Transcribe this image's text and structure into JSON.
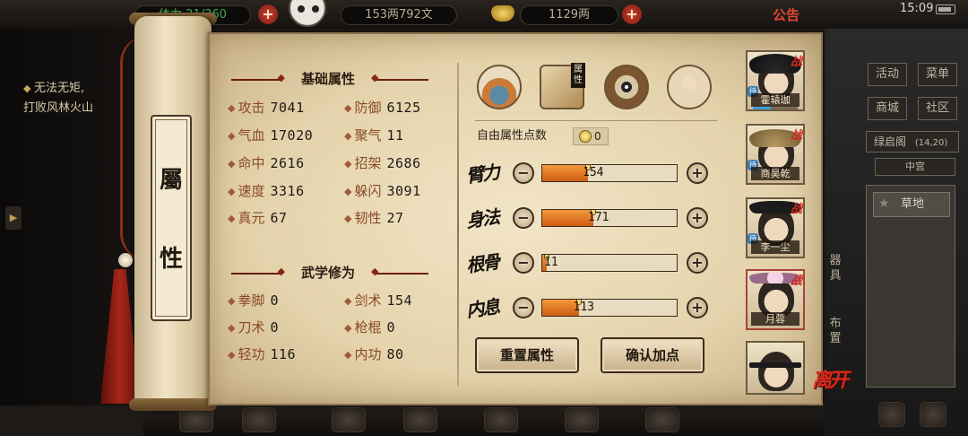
{
  "topbar": {
    "stamina": "21/360",
    "stamina_prefix": "体力",
    "money": "153两792文",
    "ingots": "1129两",
    "notice": "公告",
    "clock": "15:09"
  },
  "quest": {
    "title": "无法无矩,",
    "desc": "打败风林火山"
  },
  "scroll": {
    "char1": "屬",
    "char2": "性"
  },
  "basic": {
    "title": "基础属性",
    "stats": [
      {
        "label": "攻击",
        "value": "7041"
      },
      {
        "label": "防御",
        "value": "6125"
      },
      {
        "label": "气血",
        "value": "17020"
      },
      {
        "label": "聚气",
        "value": "11"
      },
      {
        "label": "命中",
        "value": "2616"
      },
      {
        "label": "招架",
        "value": "2686"
      },
      {
        "label": "速度",
        "value": "3316"
      },
      {
        "label": "躲闪",
        "value": "3091"
      },
      {
        "label": "真元",
        "value": "67"
      },
      {
        "label": "韧性",
        "value": "27"
      }
    ]
  },
  "martial": {
    "title": "武学修为",
    "stats": [
      {
        "label": "拳脚",
        "value": "0"
      },
      {
        "label": "剑术",
        "value": "154"
      },
      {
        "label": "刀术",
        "value": "0"
      },
      {
        "label": "枪棍",
        "value": "0"
      },
      {
        "label": "轻功",
        "value": "116"
      },
      {
        "label": "内功",
        "value": "80"
      }
    ]
  },
  "tabs": {
    "book_label": "属性"
  },
  "free_points": {
    "label": "自由属性点数",
    "value": "0"
  },
  "attributes": [
    {
      "name": "臂力",
      "value": "154",
      "fill": 0.34
    },
    {
      "name": "身法",
      "value": "171",
      "fill": 0.38
    },
    {
      "name": "根骨",
      "value": "11",
      "fill": 0.03
    },
    {
      "name": "内息",
      "value": "113",
      "fill": 0.27
    }
  ],
  "buttons": {
    "reset": "重置属性",
    "confirm": "确认加点"
  },
  "party": [
    {
      "name": "霍辕珈",
      "war": "战",
      "fight": "待"
    },
    {
      "name": "商昊乾",
      "war": "战",
      "fight": "待"
    },
    {
      "name": "李一尘",
      "war": "战",
      "fight": "待"
    },
    {
      "name": "月蓉",
      "war": "战",
      "fight": ""
    }
  ],
  "leave": "离开",
  "right_menu": {
    "activity": "活动",
    "menu": "菜单",
    "shop": "商城",
    "community": "社区",
    "location": "绿启阁",
    "coords": "(14,20)",
    "center": "中宫",
    "terrain": "草地",
    "side1": "器具",
    "side2": "布置"
  },
  "colors": {
    "accent_red": "#d4291d",
    "bar_orange": "#e07722",
    "parchment": "#f2e5c6"
  }
}
